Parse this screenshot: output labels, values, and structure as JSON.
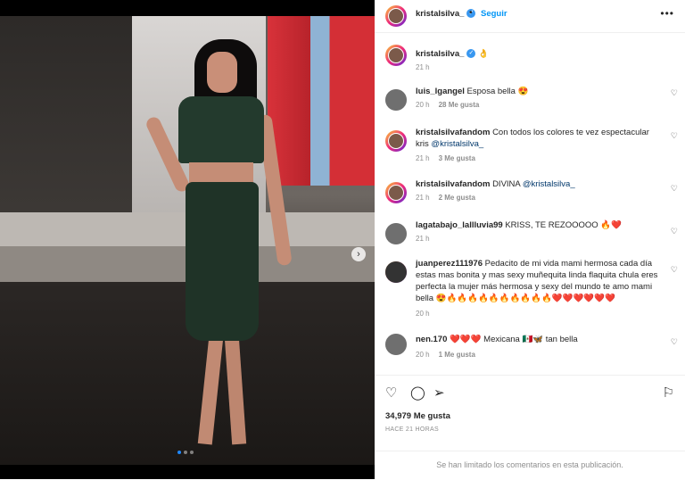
{
  "header": {
    "username": "kristalsilva_",
    "separator": "•",
    "follow_label": "Seguir",
    "more_icon": "more-horizontal-icon"
  },
  "caption": {
    "username": "kristalsilva_",
    "text": "👌",
    "time": "21 h"
  },
  "comments": [
    {
      "user": "luis_lgangel",
      "text": "Esposa bella 😍",
      "time": "20 h",
      "likes": "28 Me gusta"
    },
    {
      "user": "kristalsilvafandom",
      "text": "Con todos los colores te vez espectacular kris ",
      "mention": "@kristalsilva_",
      "time": "21 h",
      "likes": "3 Me gusta"
    },
    {
      "user": "kristalsilvafandom",
      "text": "DIVINA ",
      "mention": "@kristalsilva_",
      "time": "21 h",
      "likes": "2 Me gusta"
    },
    {
      "user": "lagatabajo_lallluvia99",
      "text": "KRISS, TE REZOOOOO 🔥❤️",
      "time": "21 h",
      "likes": ""
    },
    {
      "user": "juanperez111976",
      "text": "Pedacito de mi vida mami hermosa cada día estas mas bonita y mas sexy muñequita linda flaquita chula eres perfecta la mujer más hermosa y sexy del mundo te amo mami bella 😍🔥🔥🔥🔥🔥🔥🔥🔥🔥🔥❤️❤️❤️❤️❤️❤️",
      "time": "20 h",
      "likes": ""
    },
    {
      "user": "nen.170",
      "text": "❤️❤️❤️ Mexicana 🇲🇽🦋 tan bella",
      "time": "20 h",
      "likes": "1 Me gusta"
    }
  ],
  "actions": {
    "like_icon": "heart-icon",
    "comment_icon": "comment-icon",
    "share_icon": "send-icon",
    "save_icon": "bookmark-icon"
  },
  "likes_total": "34,979 Me gusta",
  "timestamp": "HACE 21 HORAS",
  "comments_closed": "Se han limitado los comentarios en esta publicación."
}
